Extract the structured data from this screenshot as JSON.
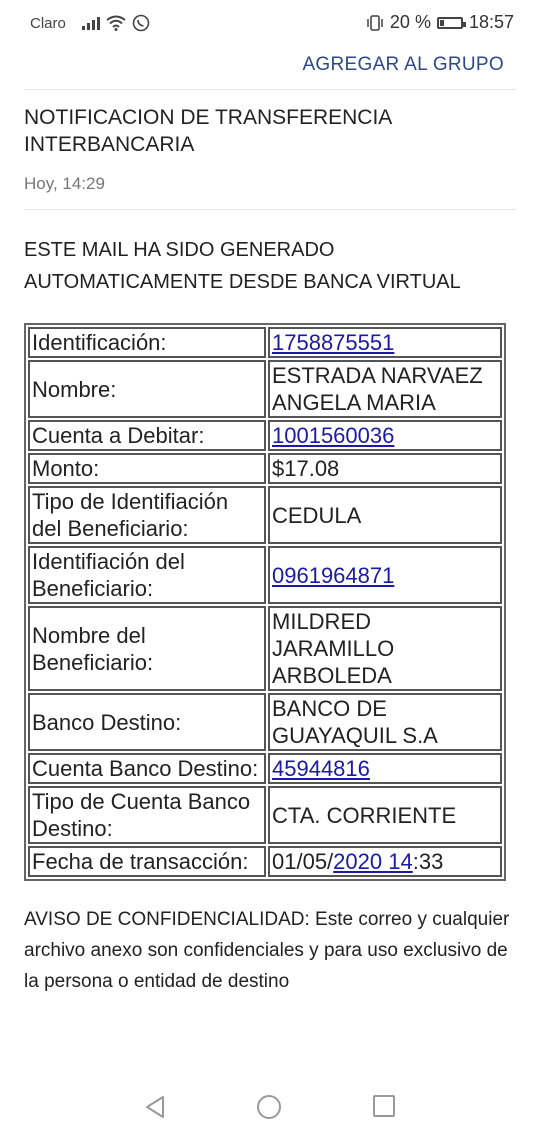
{
  "status_bar": {
    "carrier": "Claro",
    "battery_percent": "20 %",
    "battery_level": 0.2,
    "time": "18:57"
  },
  "header": {
    "action": "AGREGAR AL GRUPO",
    "accent_color": "#2c4a8a"
  },
  "email": {
    "subject": "NOTIFICACION DE TRANSFERENCIA INTERBANCARIA",
    "date": "Hoy, 14:29",
    "intro_line1": "ESTE MAIL HA SIDO GENERADO",
    "intro_line2": "AUTOMATICAMENTE DESDE BANCA VIRTUAL",
    "fields": {
      "identificacion": {
        "label": "Identificación:",
        "value": "1758875551"
      },
      "nombre": {
        "label": "Nombre:",
        "value": "ESTRADA NARVAEZ ANGELA MARIA"
      },
      "cuenta_debitar": {
        "label": "Cuenta a Debitar:",
        "value": "1001560036"
      },
      "monto": {
        "label": "Monto:",
        "value": "$17.08"
      },
      "tipo_id_beneficiario": {
        "label": "Tipo de Identifiación del Beneficiario:",
        "value": "CEDULA"
      },
      "id_beneficiario": {
        "label": "Identifiación del Beneficiario:",
        "value": "0961964871"
      },
      "nombre_beneficiario": {
        "label": "Nombre del Beneficiario:",
        "value": "MILDRED JARAMILLO ARBOLEDA"
      },
      "banco_destino": {
        "label": "Banco Destino:",
        "value": "BANCO DE GUAYAQUIL S.A"
      },
      "cuenta_banco_destino": {
        "label": "Cuenta Banco Destino:",
        "value": "45944816"
      },
      "tipo_cuenta_destino": {
        "label": "Tipo de Cuenta Banco Destino:",
        "value": "CTA. CORRIENTE"
      },
      "fecha": {
        "label": "Fecha de transacción:",
        "value_part1": "01/05/",
        "value_link1": "2020",
        "value_space": " ",
        "value_link2": "14",
        "value_part2": ":33"
      }
    },
    "confidentiality": "AVISO DE CONFIDENCIALIDAD: Este correo y cualquier archivo anexo son confidenciales y para uso exclusivo de la persona o entidad de destino",
    "link_color": "#1a1aa6"
  },
  "nav": {
    "back": "back-icon",
    "home": "home-icon",
    "recents": "recents-icon"
  }
}
